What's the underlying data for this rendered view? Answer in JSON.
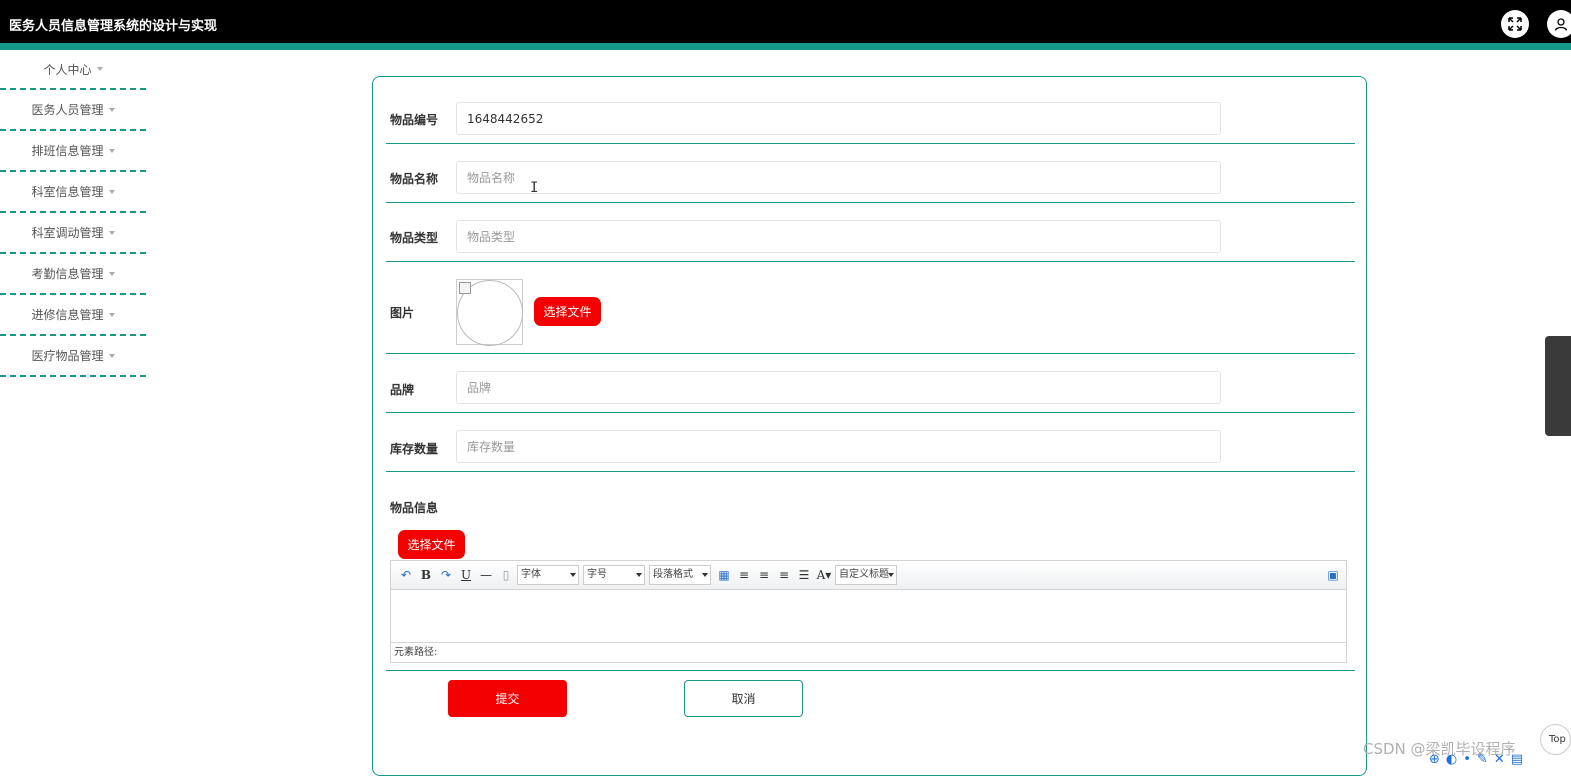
{
  "app": {
    "title": "医务人员信息管理系统的设计与实现"
  },
  "header_icons": {
    "fullscreen": "expand-icon",
    "user": "user-icon"
  },
  "sidebar": {
    "items": [
      {
        "label": "个人中心"
      },
      {
        "label": "医务人员管理"
      },
      {
        "label": "排班信息管理"
      },
      {
        "label": "科室信息管理"
      },
      {
        "label": "科室调动管理"
      },
      {
        "label": "考勤信息管理"
      },
      {
        "label": "进修信息管理"
      },
      {
        "label": "医疗物品管理"
      }
    ]
  },
  "form": {
    "item_no": {
      "label": "物品编号",
      "value": "1648442652"
    },
    "item_name": {
      "label": "物品名称",
      "placeholder": "物品名称"
    },
    "item_type": {
      "label": "物品类型",
      "placeholder": "物品类型"
    },
    "image": {
      "label": "图片",
      "button": "选择文件"
    },
    "brand": {
      "label": "品牌",
      "placeholder": "品牌"
    },
    "stock": {
      "label": "库存数量",
      "placeholder": "库存数量"
    },
    "info": {
      "label": "物品信息",
      "button": "选择文件"
    },
    "editor": {
      "font_select": "字体",
      "size_select": "字号",
      "paragraph_select": "段落格式",
      "custom_title_select": "自定义标题",
      "path_label": "元素路径:"
    },
    "submit": "提交",
    "cancel": "取消"
  },
  "overlay": {
    "top_label": "Top",
    "watermark": "CSDN @梁凯毕设程序"
  },
  "colors": {
    "accent": "#17998a",
    "primary_button": "#f50000",
    "header_bg": "#000000"
  }
}
